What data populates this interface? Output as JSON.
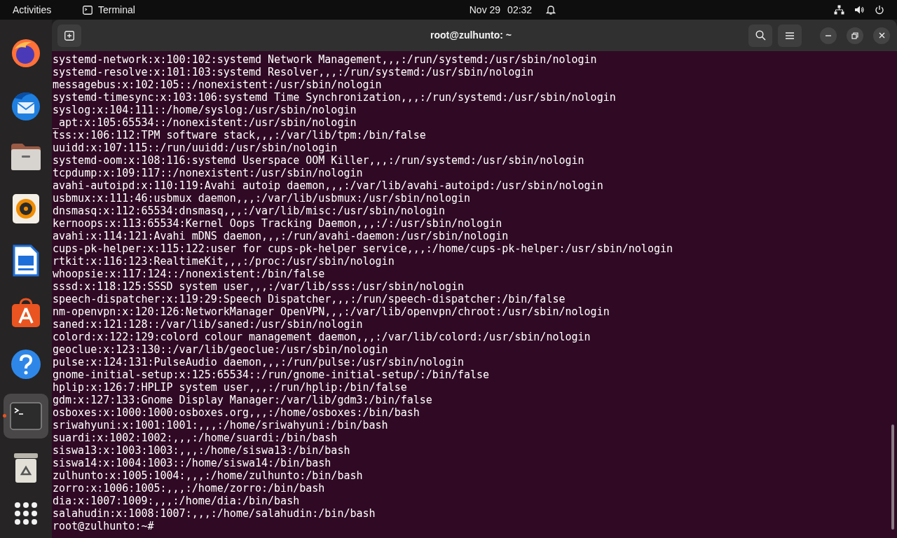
{
  "top_bar": {
    "activities": "Activities",
    "app_name": "Terminal",
    "date": "Nov 29",
    "time": "02:32"
  },
  "dock": [
    {
      "kind": "browser",
      "selected": false,
      "running": false
    },
    {
      "kind": "mail",
      "selected": false,
      "running": false
    },
    {
      "kind": "files",
      "selected": false,
      "running": false
    },
    {
      "kind": "music",
      "selected": false,
      "running": false
    },
    {
      "kind": "document",
      "selected": false,
      "running": false
    },
    {
      "kind": "store",
      "selected": false,
      "running": false
    },
    {
      "kind": "help",
      "selected": false,
      "running": false
    },
    {
      "kind": "terminal",
      "selected": true,
      "running": true
    },
    {
      "kind": "trash",
      "selected": false,
      "running": false
    }
  ],
  "window": {
    "title": "root@zulhunto: ~"
  },
  "terminal": {
    "lines": [
      "systemd-network:x:100:102:systemd Network Management,,,:/run/systemd:/usr/sbin/nologin",
      "systemd-resolve:x:101:103:systemd Resolver,,,:/run/systemd:/usr/sbin/nologin",
      "messagebus:x:102:105::/nonexistent:/usr/sbin/nologin",
      "systemd-timesync:x:103:106:systemd Time Synchronization,,,:/run/systemd:/usr/sbin/nologin",
      "syslog:x:104:111::/home/syslog:/usr/sbin/nologin",
      "_apt:x:105:65534::/nonexistent:/usr/sbin/nologin",
      "tss:x:106:112:TPM software stack,,,:/var/lib/tpm:/bin/false",
      "uuidd:x:107:115::/run/uuidd:/usr/sbin/nologin",
      "systemd-oom:x:108:116:systemd Userspace OOM Killer,,,:/run/systemd:/usr/sbin/nologin",
      "tcpdump:x:109:117::/nonexistent:/usr/sbin/nologin",
      "avahi-autoipd:x:110:119:Avahi autoip daemon,,,:/var/lib/avahi-autoipd:/usr/sbin/nologin",
      "usbmux:x:111:46:usbmux daemon,,,:/var/lib/usbmux:/usr/sbin/nologin",
      "dnsmasq:x:112:65534:dnsmasq,,,:/var/lib/misc:/usr/sbin/nologin",
      "kernoops:x:113:65534:Kernel Oops Tracking Daemon,,,:/:/usr/sbin/nologin",
      "avahi:x:114:121:Avahi mDNS daemon,,,:/run/avahi-daemon:/usr/sbin/nologin",
      "cups-pk-helper:x:115:122:user for cups-pk-helper service,,,:/home/cups-pk-helper:/usr/sbin/nologin",
      "rtkit:x:116:123:RealtimeKit,,,:/proc:/usr/sbin/nologin",
      "whoopsie:x:117:124::/nonexistent:/bin/false",
      "sssd:x:118:125:SSSD system user,,,:/var/lib/sss:/usr/sbin/nologin",
      "speech-dispatcher:x:119:29:Speech Dispatcher,,,:/run/speech-dispatcher:/bin/false",
      "nm-openvpn:x:120:126:NetworkManager OpenVPN,,,:/var/lib/openvpn/chroot:/usr/sbin/nologin",
      "saned:x:121:128::/var/lib/saned:/usr/sbin/nologin",
      "colord:x:122:129:colord colour management daemon,,,:/var/lib/colord:/usr/sbin/nologin",
      "geoclue:x:123:130::/var/lib/geoclue:/usr/sbin/nologin",
      "pulse:x:124:131:PulseAudio daemon,,,:/run/pulse:/usr/sbin/nologin",
      "gnome-initial-setup:x:125:65534::/run/gnome-initial-setup/:/bin/false",
      "hplip:x:126:7:HPLIP system user,,,:/run/hplip:/bin/false",
      "gdm:x:127:133:Gnome Display Manager:/var/lib/gdm3:/bin/false",
      "osboxes:x:1000:1000:osboxes.org,,,:/home/osboxes:/bin/bash",
      "sriwahyuni:x:1001:1001:,,,:/home/sriwahyuni:/bin/bash",
      "suardi:x:1002:1002:,,,:/home/suardi:/bin/bash",
      "siswa13:x:1003:1003:,,,:/home/siswa13:/bin/bash",
      "siswa14:x:1004:1003::/home/siswa14:/bin/bash",
      "zulhunto:x:1005:1004:,,,:/home/zulhunto:/bin/bash",
      "zorro:x:1006:1005:,,,:/home/zorro:/bin/bash",
      "dia:x:1007:1009:,,,:/home/dia:/bin/bash",
      "salahudin:x:1008:1007:,,,:/home/salahudin:/bin/bash"
    ],
    "prompt": "root@zulhunto:~#"
  }
}
